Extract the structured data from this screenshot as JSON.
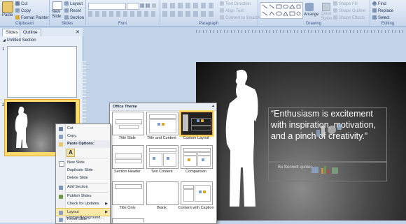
{
  "ribbon": {
    "clipboard": {
      "paste": "Paste",
      "cut": "Cut",
      "copy": "Copy",
      "format_painter": "Format Painter",
      "label": "Clipboard"
    },
    "slides": {
      "new_slide": "New",
      "new_slide2": "Slide",
      "layout": "Layout",
      "reset": "Reset",
      "section": "Section",
      "label": "Slides"
    },
    "font": {
      "label": "Font"
    },
    "paragraph": {
      "text_direction": "Text Direction",
      "align_text": "Align Text",
      "convert_smartart": "Convert to SmartArt",
      "label": "Paragraph"
    },
    "drawing": {
      "arrange": "Arrange",
      "quick_styles": "Quick",
      "quick_styles2": "Styles",
      "shape_fill": "Shape Fill",
      "shape_outline": "Shape Outline",
      "shape_effects": "Shape Effects",
      "label": "Drawing"
    },
    "editing": {
      "find": "Find",
      "replace": "Replace",
      "select": "Select",
      "label": "Editing"
    }
  },
  "pane": {
    "tabs": {
      "slides": "Slides",
      "outline": "Outline"
    },
    "section": "Untitled Section",
    "slide_numbers": [
      "1",
      "2"
    ]
  },
  "context_menu": {
    "cut": "Cut",
    "copy": "Copy",
    "paste_options": "Paste Options:",
    "new_slide": "New Slide",
    "duplicate_slide": "Duplicate Slide",
    "delete_slide": "Delete Slide",
    "add_section": "Add Section",
    "publish_slides": "Publish Slides",
    "check_updates": "Check for Updates",
    "layout": "Layout",
    "reset_slide": "Reset Slide",
    "format_background": "Format Background..."
  },
  "gallery": {
    "header": "Office Theme",
    "layouts": [
      {
        "name": "Title Slide"
      },
      {
        "name": "Title and Content"
      },
      {
        "name": "Custom Layout"
      },
      {
        "name": "Section Header"
      },
      {
        "name": "Two Content"
      },
      {
        "name": "Comparison"
      },
      {
        "name": "Title Only"
      },
      {
        "name": "Blank"
      },
      {
        "name": "Content with Caption"
      }
    ]
  },
  "slide": {
    "quote": "“Enthusiasm is excitement with inspiration, motivation, and a pinch of creativity.”",
    "author": "Bo Bennett quotes"
  },
  "colors": {
    "accent_selected": "#fbd96d",
    "ribbon": "#d1def0",
    "slide_bg": "#111111"
  }
}
